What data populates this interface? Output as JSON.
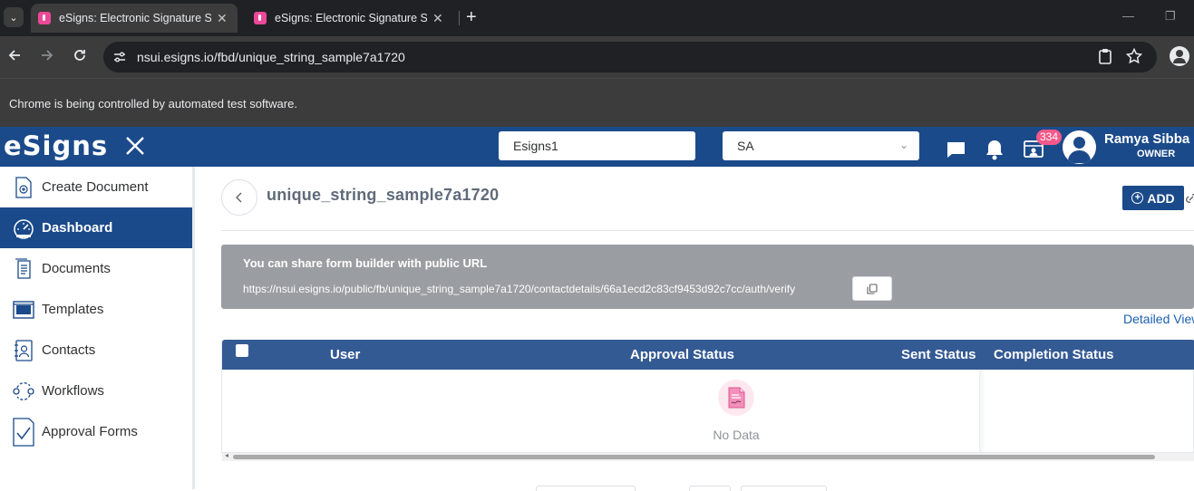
{
  "browser": {
    "tabs": [
      {
        "title": "eSigns: Electronic Signature Sof",
        "close": "✕"
      },
      {
        "title": "eSigns: Electronic Signature Sof",
        "close": "✕"
      }
    ],
    "new_tab": "+",
    "url": "nsui.esigns.io/fbd/unique_string_sample7a1720",
    "automation_notice": "Chrome is being controlled by automated test software."
  },
  "header": {
    "logo": "eSigns",
    "company_value": "Esigns1",
    "role_value": "SA",
    "notification_count": "334",
    "user_name": "Ramya Sibba",
    "user_role": "OWNER"
  },
  "sidebar": {
    "items": [
      {
        "label": "Create Document",
        "icon": "create-document-icon"
      },
      {
        "label": "Dashboard",
        "icon": "dashboard-icon"
      },
      {
        "label": "Documents",
        "icon": "documents-icon"
      },
      {
        "label": "Templates",
        "icon": "templates-icon"
      },
      {
        "label": "Contacts",
        "icon": "contacts-icon"
      },
      {
        "label": "Workflows",
        "icon": "workflows-icon"
      },
      {
        "label": "Approval Forms",
        "icon": "approval-forms-icon"
      }
    ],
    "active": "Dashboard"
  },
  "main": {
    "title": "unique_string_sample7a1720",
    "add_label": "ADD",
    "share": {
      "title": "You can share form builder with public URL",
      "url": "https://nsui.esigns.io/public/fb/unique_string_sample7a1720/contactdetails/66a1ecd2c83cf9453d92c7cc/auth/verify"
    },
    "detailed_view": "Detailed View",
    "table": {
      "columns": [
        "User",
        "Approval Status",
        "Sent Status",
        "Completion Status"
      ],
      "rows": [],
      "empty_text": "No Data"
    }
  },
  "colors": {
    "brand": "#1b4a8a",
    "table_header": "#345a94",
    "badge": "#f5588a",
    "share_box": "#9a9da2"
  }
}
